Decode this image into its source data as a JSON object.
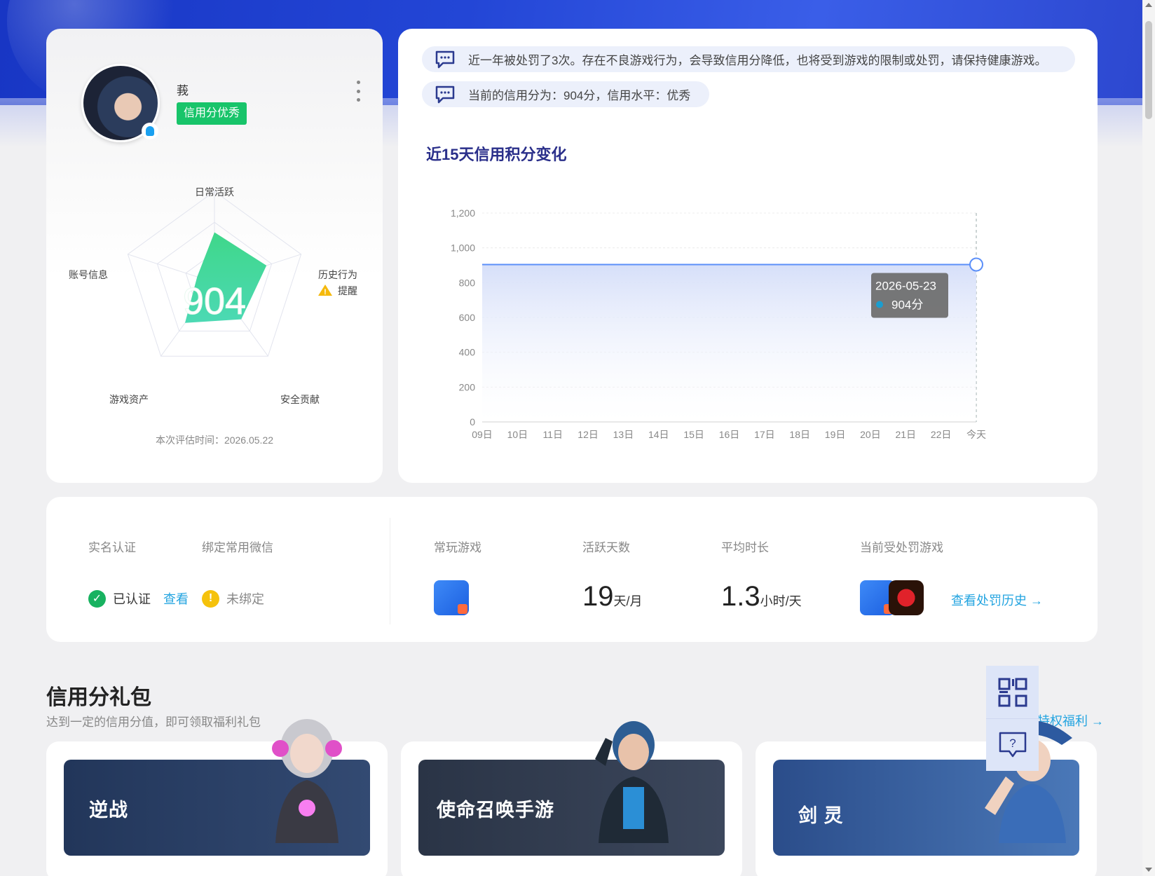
{
  "profile": {
    "username": "莪",
    "credit_badge": "信用分优秀",
    "score": "904",
    "eval_time": "本次评估时间：2026.05.22",
    "radar": {
      "axes": [
        {
          "label": "日常活跃",
          "value": 0.55
        },
        {
          "label": "历史行为",
          "value": 0.6,
          "warning": "提醒"
        },
        {
          "label": "安全贡献",
          "value": 0.5
        },
        {
          "label": "游戏资产",
          "value": 0.55
        },
        {
          "label": "账号信息",
          "value": 0.2
        }
      ]
    }
  },
  "notices": [
    "近一年被处罚了3次。存在不良游戏行为，会导致信用分降低，也将受到游戏的限制或处罚，请保持健康游戏。",
    "当前的信用分为：904分，信用水平：优秀"
  ],
  "chart_title": "近15天信用积分变化",
  "chart_data": {
    "type": "area",
    "x": [
      "09日",
      "10日",
      "11日",
      "12日",
      "13日",
      "14日",
      "15日",
      "16日",
      "17日",
      "18日",
      "19日",
      "20日",
      "21日",
      "22日",
      "今天"
    ],
    "series": [
      {
        "values": [
          904,
          904,
          904,
          904,
          904,
          904,
          904,
          904,
          904,
          904,
          904,
          904,
          904,
          904,
          904
        ]
      }
    ],
    "ylim": [
      0,
      1200
    ],
    "yticks": [
      "0",
      "200",
      "400",
      "600",
      "800",
      "1,000",
      "1,200"
    ],
    "tooltip": {
      "date": "2026-05-23",
      "value": "904分"
    },
    "grid": true,
    "colors": {
      "line": "#5b8ff9",
      "fill": "#dfe6fb"
    }
  },
  "stats": {
    "realname_label": "实名认证",
    "wechat_label": "绑定常用微信",
    "realname_status": "已认证",
    "realname_link": "查看",
    "wechat_status": "未绑定",
    "frequent_games_label": "常玩游戏",
    "active_days_label": "活跃天数",
    "active_days_value": "19",
    "active_days_unit": "天/月",
    "avg_time_label": "平均时长",
    "avg_time_value": "1.3",
    "avg_time_unit": "小时/天",
    "punished_games_label": "当前受处罚游戏",
    "punish_history_link": "查看处罚历史 →"
  },
  "gift_section": {
    "title": "信用分礼包",
    "subtitle": "达到一定的信用分值，即可领取福利礼包",
    "link": "特权福利 →",
    "games": [
      {
        "name": "逆战",
        "color": "#24385a"
      },
      {
        "name": "使命召唤手游",
        "color": "#2a3446"
      },
      {
        "name": "剑 灵",
        "color": "#2c4f8a"
      }
    ]
  },
  "icons": {
    "qr": "qrcode-icon",
    "help": "help-chat-icon",
    "message": "message-icon"
  }
}
